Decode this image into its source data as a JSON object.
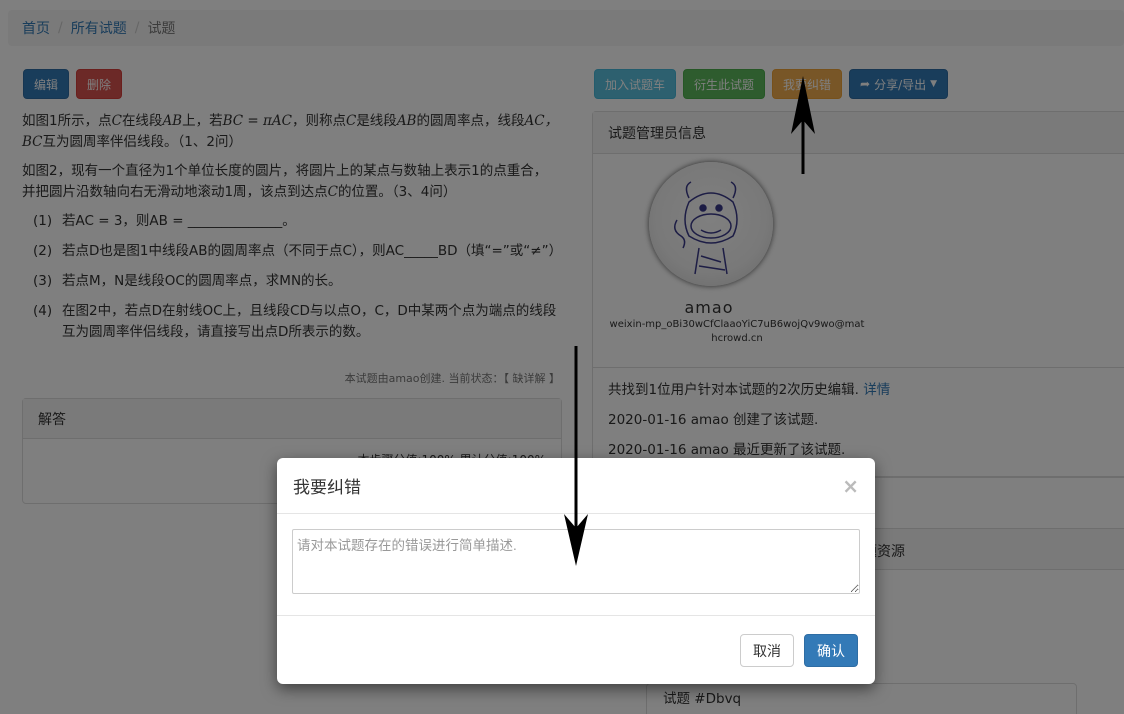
{
  "breadcrumb": {
    "home": "首页",
    "all": "所有试题",
    "current": "试题"
  },
  "left_buttons": {
    "edit": "编辑",
    "delete": "删除"
  },
  "right_buttons": {
    "cart": "加入试题车",
    "derive": "衍生此试题",
    "report": "我要纠错",
    "share": "分享/导出"
  },
  "question": {
    "p1_a": "如图1所示，点",
    "p1_b": "C",
    "p1_c": "在线段",
    "p1_d": "AB",
    "p1_e": "上，若",
    "p1_f": "BC = πAC",
    "p1_g": "，则称点",
    "p1_h": "C",
    "p1_i": "是线段",
    "p1_j": "AB",
    "p1_k": "的圆周率点，线段",
    "p1_l": "AC，BC",
    "p1_m": "互为圆周率伴侣线段。（1、2问）",
    "p2_a": "如图2，现有一个直径为1个单位长度的圆片，将圆片上的某点与数轴上表示1的点重合，并把圆片沿数轴向右无滑动地滚动1周，该点到达点",
    "p2_b": "C",
    "p2_c": "的位置。（3、4问）",
    "items": [
      {
        "num": "(1)",
        "text": "若AC = 3，则AB = ______________。"
      },
      {
        "num": "(2)",
        "text": "若点D也是图1中线段AB的圆周率点（不同于点C），则AC_____BD（填“=”或“≠”）"
      },
      {
        "num": "(3)",
        "text": "若点M，N是线段OC的圆周率点，求MN的长。"
      },
      {
        "num": "(4)",
        "text": "在图2中，若点D在射线OC上，且线段CD与以点O，C，D中某两个点为端点的线段互为圆周率伴侣线段，请直接写出点D所表示的数。"
      }
    ],
    "creator": "本试题由amao创建. 当前状态：【 缺详解 】"
  },
  "answer": {
    "title": "解答",
    "body": "本步骤分值:100% 累计分值:100%"
  },
  "admin": {
    "title": "试题管理员信息",
    "username": "amao",
    "email": "weixin-mp_oBi30wCfClaaoYiC7uB6wojQv9wo@mathcrowd.cn",
    "history_summary": "共找到1位用户针对本试题的2次历史编辑.",
    "history_link": "详情",
    "history_1": "2020-01-16 amao 创建了该试题.",
    "history_2": "2020-01-16 amao 最近更新了该试题."
  },
  "resource_panel": {
    "title_fragment": "题资源"
  },
  "question_id": "试题 #Dbvq",
  "modal": {
    "title": "我要纠错",
    "close": "×",
    "placeholder": "请对本试题存在的错误进行简单描述.",
    "cancel": "取消",
    "confirm": "确认"
  },
  "colors": {
    "primary": "#337ab7",
    "danger": "#d9534f",
    "info": "#5bc0de",
    "success": "#5cb85c",
    "warning": "#f0ad4e"
  },
  "icons": {
    "share": "share-icon",
    "caret": "caret-down-icon",
    "close": "close-icon",
    "arrow_up": "arrow-up-icon",
    "arrow_down": "arrow-down-icon"
  }
}
